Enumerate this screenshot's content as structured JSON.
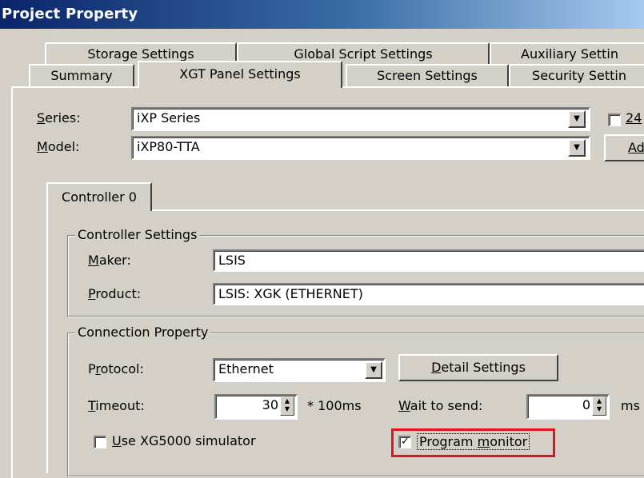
{
  "window": {
    "title": "Project Property"
  },
  "tabs": {
    "row1": [
      "Storage Settings",
      "Global Script Settings",
      "Auxiliary Settin"
    ],
    "row2": [
      "Summary",
      "XGT Panel Settings",
      "Screen Settings",
      "Security Settin"
    ]
  },
  "series": {
    "label": "Series:",
    "label_key": "S",
    "label_rest": "eries:",
    "value": "iXP Series"
  },
  "model": {
    "label": "Model:",
    "label_key": "M",
    "label_rest": "odel:",
    "value": "iXP80-TTA"
  },
  "right_check": {
    "label": "24"
  },
  "right_button": {
    "label": "Ad"
  },
  "controller_tab": {
    "label": "Controller 0"
  },
  "controller_settings": {
    "title": "Controller Settings",
    "maker_label_key": "M",
    "maker_label_rest": "aker:",
    "maker_value": "LSIS",
    "product_label_key": "P",
    "product_label_rest": "roduct:",
    "product_value": "LSIS: XGK (ETHERNET)"
  },
  "connection": {
    "title": "Connection Property",
    "protocol_label_a": "P",
    "protocol_label_key": "r",
    "protocol_label_rest": "otocol:",
    "protocol_value": "Ethernet",
    "detail_key": "D",
    "detail_rest": "etail Settings",
    "timeout_label_key": "T",
    "timeout_label_rest": "imeout:",
    "timeout_value": "30",
    "timeout_unit": "* 100ms",
    "wait_label_key": "W",
    "wait_label_rest": "ait to send:",
    "wait_value": "0",
    "wait_unit": "ms",
    "simulator_key": "U",
    "simulator_rest": "se XG5000 simulator",
    "simulator_checked": false,
    "monitor_label_a": "Program ",
    "monitor_key": "m",
    "monitor_rest": "onitor",
    "monitor_checked": true
  },
  "colors": {
    "highlight": "#e0141e",
    "title_start": "#0a246a",
    "title_end": "#a6caf0"
  }
}
